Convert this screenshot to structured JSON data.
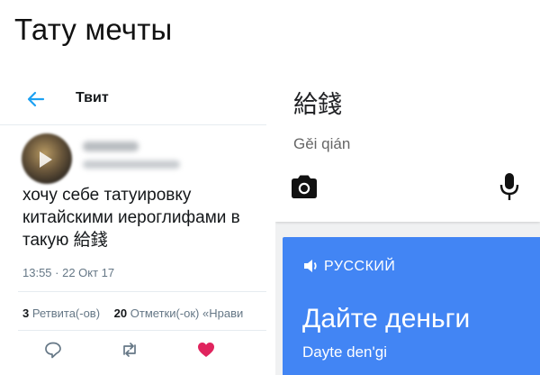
{
  "meme": {
    "title": "Тату мечты"
  },
  "tweet": {
    "header_title": "Твит",
    "text_lines": [
      "хочу себе татуировку",
      "китайскими иероглифами в",
      "такую 給錢"
    ],
    "timestamp": "13:55 · 22 Окт 17",
    "retweets_count": "3",
    "retweets_label": "Ретвита(-ов)",
    "likes_count": "20",
    "likes_label": "Отметки(-ок) «Нрави",
    "icons": [
      "back-arrow-icon",
      "reply-icon",
      "retweet-icon",
      "heart-icon"
    ],
    "colors": {
      "accent": "#1da1f2",
      "heart": "#e0245e",
      "muted": "#657786"
    }
  },
  "translator": {
    "source_text": "給錢",
    "romanization": "Gěi qián",
    "target_language": "РУССКИЙ",
    "translation": "Дайте деньги",
    "transliteration": "Dayte den'gi",
    "icons": [
      "camera-icon",
      "microphone-icon",
      "speaker-icon"
    ],
    "colors": {
      "panel": "#4285f4"
    }
  }
}
